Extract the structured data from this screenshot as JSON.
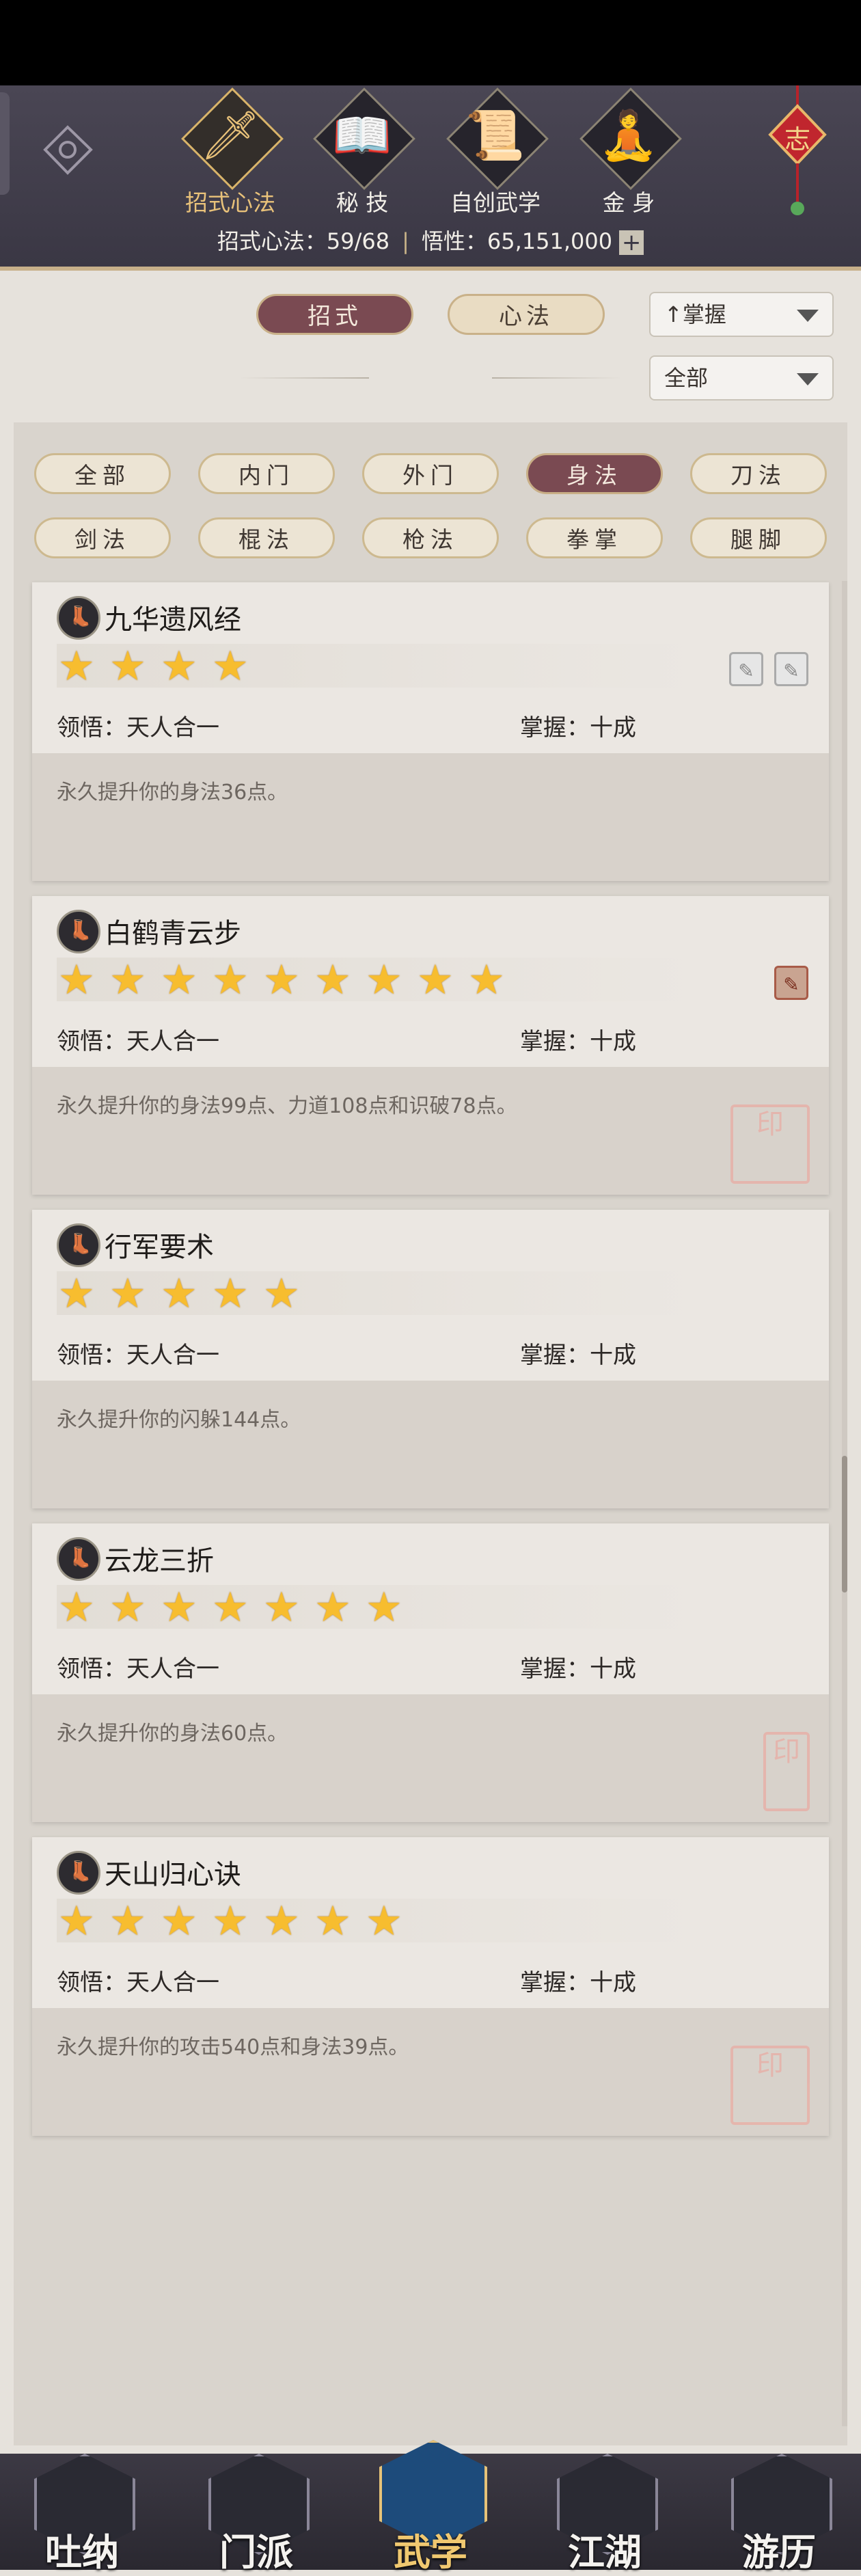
{
  "header": {
    "nav": [
      {
        "label": "招式心法",
        "icon": "sword-icon",
        "active": true
      },
      {
        "label": "秘 技",
        "icon": "book-icon",
        "active": false
      },
      {
        "label": "自创武学",
        "icon": "scroll-icon",
        "active": false
      },
      {
        "label": "金 身",
        "icon": "meditation-icon",
        "active": false
      }
    ],
    "stats": {
      "skills_label": "招式心法：",
      "skills_value": "59/68",
      "insight_label": "悟性：",
      "insight_value": "65,151,000",
      "plus": "+"
    },
    "knot_char": "志"
  },
  "toggles": {
    "zhaoshi": "招式",
    "xinfa": "心法"
  },
  "sort_select": "↑掌握",
  "filter_select": "全部",
  "categories": [
    {
      "label": "全部",
      "active": false
    },
    {
      "label": "内门",
      "active": false
    },
    {
      "label": "外门",
      "active": false
    },
    {
      "label": "身法",
      "active": true
    },
    {
      "label": "刀法",
      "active": false
    },
    {
      "label": "剑法",
      "active": false
    },
    {
      "label": "棍法",
      "active": false
    },
    {
      "label": "枪法",
      "active": false
    },
    {
      "label": "拳掌",
      "active": false
    },
    {
      "label": "腿脚",
      "active": false
    }
  ],
  "cards": [
    {
      "name": "九华遗风经",
      "stars": 4,
      "comprehension": "领悟：天人合一",
      "mastery": "掌握：十成",
      "desc": "永久提升你的身法36点。",
      "badges": [
        "gray",
        "gray"
      ],
      "seal": null
    },
    {
      "name": "白鹤青云步",
      "stars": 9,
      "comprehension": "领悟：天人合一",
      "mastery": "掌握：十成",
      "desc": "永久提升你的身法99点、力道108点和识破78点。",
      "badges": [
        "red"
      ],
      "seal": "seal"
    },
    {
      "name": "行军要术",
      "stars": 5,
      "comprehension": "领悟：天人合一",
      "mastery": "掌握：十成",
      "desc": "永久提升你的闪躲144点。",
      "badges": [],
      "seal": null
    },
    {
      "name": "云龙三折",
      "stars": 7,
      "comprehension": "领悟：天人合一",
      "mastery": "掌握：十成",
      "desc": "永久提升你的身法60点。",
      "badges": [],
      "seal": "seal"
    },
    {
      "name": "天山归心诀",
      "stars": 7,
      "comprehension": "领悟：天人合一",
      "mastery": "掌握：十成",
      "desc": "永久提升你的攻击540点和身法39点。",
      "badges": [],
      "seal": "seal"
    }
  ],
  "bottom_nav": [
    {
      "label": "吐纳",
      "active": false
    },
    {
      "label": "门派",
      "active": false
    },
    {
      "label": "武学",
      "active": true
    },
    {
      "label": "江湖",
      "active": false
    },
    {
      "label": "游历",
      "active": false
    }
  ]
}
